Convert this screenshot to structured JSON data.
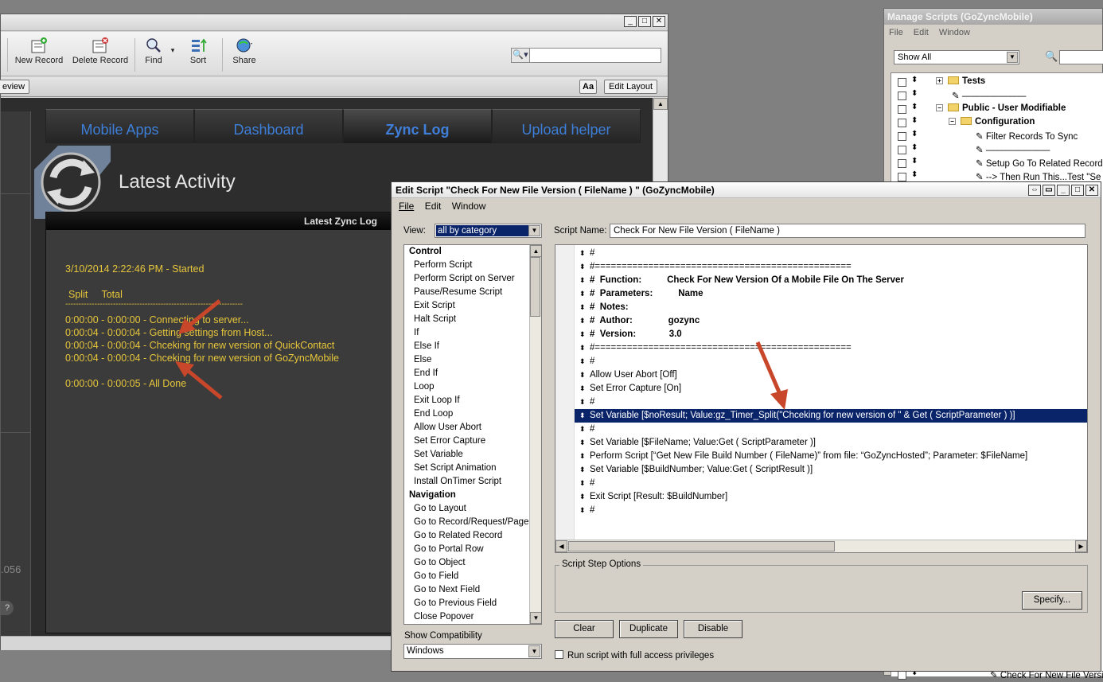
{
  "fm": {
    "toolbar": {
      "new_record": "New Record",
      "delete_record": "Delete Record",
      "find": "Find",
      "sort": "Sort",
      "share": "Share"
    },
    "layoutbar": {
      "preview_label": "eview",
      "aa_label": "Aa",
      "edit_layout": "Edit Layout"
    },
    "tabs": [
      "Mobile Apps",
      "Dashboard",
      "Zync Log",
      "Upload helper"
    ],
    "active_tab": "Zync Log",
    "latest_title": "Latest Activity",
    "log_header": "Latest Zync Log",
    "log": {
      "started": "3/10/2014 2:22:46 PM - Started",
      "col_headers": "Split     Total",
      "divider": "-------------------------------------------------------------------",
      "lines": [
        "0:00:00 - 0:00:00 - Connecting to server...",
        "0:00:04 - 0:00:04 - Getting settings from Host...",
        "0:00:04 - 0:00:04 - Chceking for new version of QuickContact",
        "0:00:04 - 0:00:04 - Chceking for new version of GoZyncMobile"
      ],
      "done": "0:00:00 - 0:00:05 - All Done"
    },
    "version_fragment": ".056",
    "help": "?"
  },
  "manage_scripts": {
    "title": "Manage Scripts (GoZyncMobile)",
    "menu": [
      "File",
      "Edit",
      "Window"
    ],
    "show_all": "Show All",
    "rows": [
      {
        "label": "Tests",
        "kind": "folder",
        "expanded": false,
        "bold": true
      },
      {
        "label": "———————",
        "kind": "divider"
      },
      {
        "label": "Public - User Modifiable",
        "kind": "folder",
        "expanded": true,
        "bold": true
      },
      {
        "label": "Configuration",
        "kind": "folder",
        "expanded": true,
        "bold": true
      },
      {
        "label": "Filter Records To Sync",
        "kind": "script"
      },
      {
        "label": "———————",
        "kind": "divider"
      },
      {
        "label": "Setup Go To Related Records",
        "kind": "script"
      },
      {
        "label": "--> Then Run This...Test \"Se",
        "kind": "script"
      }
    ],
    "bottom_row": "Check For New File Version"
  },
  "edit_script": {
    "title": "Edit Script \"Check For New File Version ( FileName  ) \" (GoZyncMobile)",
    "menu": [
      "File",
      "Edit",
      "Window"
    ],
    "view_label": "View:",
    "view_value": "all by category",
    "script_name_label": "Script Name:",
    "script_name": "Check For New File Version ( FileName  )",
    "steps": [
      {
        "label": "Control",
        "cat": true
      },
      {
        "label": "Perform Script"
      },
      {
        "label": "Perform Script on Server"
      },
      {
        "label": "Pause/Resume Script"
      },
      {
        "label": "Exit Script"
      },
      {
        "label": "Halt Script"
      },
      {
        "label": "If"
      },
      {
        "label": "Else If"
      },
      {
        "label": "Else"
      },
      {
        "label": "End If"
      },
      {
        "label": "Loop"
      },
      {
        "label": "Exit Loop If"
      },
      {
        "label": "End Loop"
      },
      {
        "label": "Allow User Abort"
      },
      {
        "label": "Set Error Capture"
      },
      {
        "label": "Set Variable"
      },
      {
        "label": "Set Script Animation"
      },
      {
        "label": "Install OnTimer Script"
      },
      {
        "label": "Navigation",
        "cat": true
      },
      {
        "label": "Go to Layout"
      },
      {
        "label": "Go to Record/Request/Page"
      },
      {
        "label": "Go to Related Record"
      },
      {
        "label": "Go to Portal Row"
      },
      {
        "label": "Go to Object"
      },
      {
        "label": "Go to Field"
      },
      {
        "label": "Go to Next Field"
      },
      {
        "label": "Go to Previous Field"
      },
      {
        "label": "Close Popover"
      }
    ],
    "script_lines": [
      {
        "text": "#"
      },
      {
        "text": "#================================================"
      },
      {
        "text": "#  Function:          Check For New Version Of a Mobile File On The Server",
        "bold": true
      },
      {
        "text": "#  Parameters:          Name",
        "bold": true
      },
      {
        "text": "#  Notes:",
        "bold": true
      },
      {
        "text": "#  Author:              gozync",
        "bold": true
      },
      {
        "text": "#  Version:             3.0",
        "bold": true
      },
      {
        "text": "#================================================"
      },
      {
        "text": "#"
      },
      {
        "text": "Allow User Abort [Off]"
      },
      {
        "text": "Set Error Capture [On]"
      },
      {
        "text": "#"
      },
      {
        "text": "Set Variable [$noResult; Value:gz_Timer_Split(\"Chceking for new version of \" & Get ( ScriptParameter ) )]",
        "selected": true
      },
      {
        "text": "#"
      },
      {
        "text": "Set Variable [$FileName; Value:Get ( ScriptParameter )]"
      },
      {
        "text": "Perform Script [“Get New File Build Number ( FileName)” from file: “GoZyncHosted”; Parameter: $FileName]"
      },
      {
        "text": "Set Variable [$BuildNumber; Value:Get ( ScriptResult )]"
      },
      {
        "text": "#"
      },
      {
        "text": "Exit Script [Result: $BuildNumber]"
      },
      {
        "text": "#"
      }
    ],
    "step_options_label": "Script Step Options",
    "specify": "Specify...",
    "clear": "Clear",
    "duplicate": "Duplicate",
    "disable": "Disable",
    "compat_label": "Show Compatibility",
    "compat_value": "Windows",
    "full_access": "Run script with full access privileges"
  }
}
